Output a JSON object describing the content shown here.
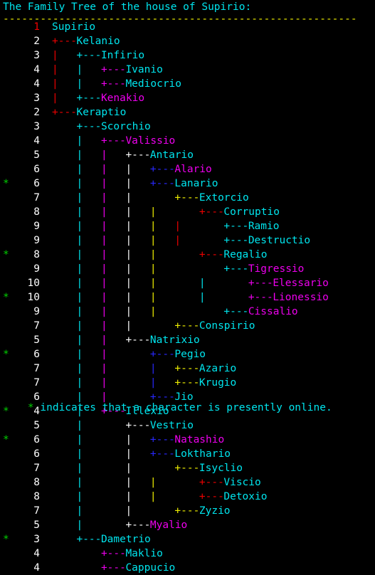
{
  "header": {
    "title": "The Family Tree of the house of Supirio:",
    "rule": "---------------------------------------------------------",
    "title_color": "#00e5ee",
    "rule_color": "#eeee00"
  },
  "footer": {
    "marker": "*",
    "text": " indicates that a character is presently online.",
    "marker_color": "#00d000",
    "text_color": "#00e5ee"
  },
  "legend": {
    "online_marker": "*",
    "online_meaning": "character is presently online"
  },
  "colors": {
    "depth_1": "#ee0000",
    "depth_2": "#ee0000",
    "depth_3": "#00e5ee",
    "depth_4": "#ee00ee",
    "depth_5": "#ffffff",
    "depth_6": "#2828ff",
    "depth_7": "#eeee00",
    "depth_8": "#ee0000",
    "depth_9": "#00e5ee",
    "depth_10": "#ee00ee",
    "name_cyan": "#00e5ee",
    "name_magenta": "#ee00ee",
    "number_white": "#ffffff",
    "number_root": "#ee0000",
    "online_green": "#00d000",
    "background": "#000000"
  },
  "tree": {
    "root": "Supirio",
    "columns": {
      "indent_per_level": 4,
      "connector": "+---",
      "vertical": "|"
    },
    "rows": [
      {
        "depth": 1,
        "name": "Supirio",
        "name_color": "cyan",
        "online": false,
        "prefix": [],
        "connector_color": null,
        "depth_color": "red"
      },
      {
        "depth": 2,
        "name": "Kelanio",
        "name_color": "cyan",
        "online": false,
        "prefix": [],
        "connector_color": "red",
        "depth_color": "white"
      },
      {
        "depth": 3,
        "name": "Infirio",
        "name_color": "cyan",
        "online": false,
        "prefix": [
          {
            "col": 0,
            "color": "red"
          }
        ],
        "connector_color": "cyan",
        "depth_color": "white"
      },
      {
        "depth": 4,
        "name": "Ivanio",
        "name_color": "cyan",
        "online": false,
        "prefix": [
          {
            "col": 0,
            "color": "red"
          },
          {
            "col": 1,
            "color": "cyan"
          }
        ],
        "connector_color": "magenta",
        "depth_color": "white"
      },
      {
        "depth": 4,
        "name": "Mediocrio",
        "name_color": "cyan",
        "online": false,
        "prefix": [
          {
            "col": 0,
            "color": "red"
          },
          {
            "col": 1,
            "color": "cyan"
          }
        ],
        "connector_color": "magenta",
        "depth_color": "white"
      },
      {
        "depth": 3,
        "name": "Kenakio",
        "name_color": "magenta",
        "online": false,
        "prefix": [
          {
            "col": 0,
            "color": "red"
          }
        ],
        "connector_color": "cyan",
        "depth_color": "white"
      },
      {
        "depth": 2,
        "name": "Keraptio",
        "name_color": "cyan",
        "online": false,
        "prefix": [],
        "connector_color": "red",
        "depth_color": "white"
      },
      {
        "depth": 3,
        "name": "Scorchio",
        "name_color": "cyan",
        "online": false,
        "prefix": [],
        "connector_color": "cyan",
        "depth_color": "white"
      },
      {
        "depth": 4,
        "name": "Valissio",
        "name_color": "magenta",
        "online": false,
        "prefix": [
          {
            "col": 1,
            "color": "cyan"
          }
        ],
        "connector_color": "magenta",
        "depth_color": "white"
      },
      {
        "depth": 5,
        "name": "Antario",
        "name_color": "cyan",
        "online": false,
        "prefix": [
          {
            "col": 1,
            "color": "cyan"
          },
          {
            "col": 2,
            "color": "magenta"
          }
        ],
        "connector_color": "white",
        "depth_color": "white"
      },
      {
        "depth": 6,
        "name": "Alario",
        "name_color": "magenta",
        "online": false,
        "prefix": [
          {
            "col": 1,
            "color": "cyan"
          },
          {
            "col": 2,
            "color": "magenta"
          },
          {
            "col": 3,
            "color": "white"
          }
        ],
        "connector_color": "blue",
        "depth_color": "white"
      },
      {
        "depth": 6,
        "name": "Lanario",
        "name_color": "cyan",
        "online": true,
        "prefix": [
          {
            "col": 1,
            "color": "cyan"
          },
          {
            "col": 2,
            "color": "magenta"
          },
          {
            "col": 3,
            "color": "white"
          }
        ],
        "connector_color": "blue",
        "depth_color": "white"
      },
      {
        "depth": 7,
        "name": "Extorcio",
        "name_color": "cyan",
        "online": false,
        "prefix": [
          {
            "col": 1,
            "color": "cyan"
          },
          {
            "col": 2,
            "color": "magenta"
          },
          {
            "col": 3,
            "color": "white"
          }
        ],
        "connector_color": "yellow",
        "depth_color": "white"
      },
      {
        "depth": 8,
        "name": "Corruptio",
        "name_color": "cyan",
        "online": false,
        "prefix": [
          {
            "col": 1,
            "color": "cyan"
          },
          {
            "col": 2,
            "color": "magenta"
          },
          {
            "col": 3,
            "color": "white"
          },
          {
            "col": 4,
            "color": "yellow"
          }
        ],
        "connector_color": "red",
        "depth_color": "white"
      },
      {
        "depth": 9,
        "name": "Ramio",
        "name_color": "cyan",
        "online": false,
        "prefix": [
          {
            "col": 1,
            "color": "cyan"
          },
          {
            "col": 2,
            "color": "magenta"
          },
          {
            "col": 3,
            "color": "white"
          },
          {
            "col": 4,
            "color": "yellow"
          },
          {
            "col": 5,
            "color": "red"
          }
        ],
        "connector_color": "cyan",
        "depth_color": "white"
      },
      {
        "depth": 9,
        "name": "Destructio",
        "name_color": "cyan",
        "online": false,
        "prefix": [
          {
            "col": 1,
            "color": "cyan"
          },
          {
            "col": 2,
            "color": "magenta"
          },
          {
            "col": 3,
            "color": "white"
          },
          {
            "col": 4,
            "color": "yellow"
          },
          {
            "col": 5,
            "color": "red"
          }
        ],
        "connector_color": "cyan",
        "depth_color": "white"
      },
      {
        "depth": 8,
        "name": "Regalio",
        "name_color": "cyan",
        "online": true,
        "prefix": [
          {
            "col": 1,
            "color": "cyan"
          },
          {
            "col": 2,
            "color": "magenta"
          },
          {
            "col": 3,
            "color": "white"
          },
          {
            "col": 4,
            "color": "yellow"
          }
        ],
        "connector_color": "red",
        "depth_color": "white"
      },
      {
        "depth": 9,
        "name": "Tigressio",
        "name_color": "magenta",
        "online": false,
        "prefix": [
          {
            "col": 1,
            "color": "cyan"
          },
          {
            "col": 2,
            "color": "magenta"
          },
          {
            "col": 3,
            "color": "white"
          },
          {
            "col": 4,
            "color": "yellow"
          }
        ],
        "connector_color": "cyan",
        "depth_color": "white"
      },
      {
        "depth": 10,
        "name": "Elessario",
        "name_color": "magenta",
        "online": false,
        "prefix": [
          {
            "col": 1,
            "color": "cyan"
          },
          {
            "col": 2,
            "color": "magenta"
          },
          {
            "col": 3,
            "color": "white"
          },
          {
            "col": 4,
            "color": "yellow"
          },
          {
            "col": 6,
            "color": "cyan"
          }
        ],
        "connector_color": "magenta",
        "depth_color": "white"
      },
      {
        "depth": 10,
        "name": "Lionessio",
        "name_color": "magenta",
        "online": true,
        "prefix": [
          {
            "col": 1,
            "color": "cyan"
          },
          {
            "col": 2,
            "color": "magenta"
          },
          {
            "col": 3,
            "color": "white"
          },
          {
            "col": 4,
            "color": "yellow"
          },
          {
            "col": 6,
            "color": "cyan"
          }
        ],
        "connector_color": "magenta",
        "depth_color": "white"
      },
      {
        "depth": 9,
        "name": "Cissalio",
        "name_color": "magenta",
        "online": false,
        "prefix": [
          {
            "col": 1,
            "color": "cyan"
          },
          {
            "col": 2,
            "color": "magenta"
          },
          {
            "col": 3,
            "color": "white"
          },
          {
            "col": 4,
            "color": "yellow"
          }
        ],
        "connector_color": "cyan",
        "depth_color": "white"
      },
      {
        "depth": 7,
        "name": "Conspirio",
        "name_color": "cyan",
        "online": false,
        "prefix": [
          {
            "col": 1,
            "color": "cyan"
          },
          {
            "col": 2,
            "color": "magenta"
          },
          {
            "col": 3,
            "color": "white"
          }
        ],
        "connector_color": "yellow",
        "depth_color": "white"
      },
      {
        "depth": 5,
        "name": "Natrixio",
        "name_color": "cyan",
        "online": false,
        "prefix": [
          {
            "col": 1,
            "color": "cyan"
          },
          {
            "col": 2,
            "color": "magenta"
          }
        ],
        "connector_color": "white",
        "depth_color": "white"
      },
      {
        "depth": 6,
        "name": "Pegio",
        "name_color": "cyan",
        "online": true,
        "prefix": [
          {
            "col": 1,
            "color": "cyan"
          },
          {
            "col": 2,
            "color": "magenta"
          }
        ],
        "connector_color": "blue",
        "depth_color": "white"
      },
      {
        "depth": 7,
        "name": "Azario",
        "name_color": "cyan",
        "online": false,
        "prefix": [
          {
            "col": 1,
            "color": "cyan"
          },
          {
            "col": 2,
            "color": "magenta"
          },
          {
            "col": 4,
            "color": "blue"
          }
        ],
        "connector_color": "yellow",
        "depth_color": "white"
      },
      {
        "depth": 7,
        "name": "Krugio",
        "name_color": "cyan",
        "online": false,
        "prefix": [
          {
            "col": 1,
            "color": "cyan"
          },
          {
            "col": 2,
            "color": "magenta"
          },
          {
            "col": 4,
            "color": "blue"
          }
        ],
        "connector_color": "yellow",
        "depth_color": "white"
      },
      {
        "depth": 6,
        "name": "Jio",
        "name_color": "cyan",
        "online": false,
        "prefix": [
          {
            "col": 1,
            "color": "cyan"
          },
          {
            "col": 2,
            "color": "magenta"
          }
        ],
        "connector_color": "blue",
        "depth_color": "white"
      },
      {
        "depth": 4,
        "name": "Illexio",
        "name_color": "cyan",
        "online": true,
        "prefix": [
          {
            "col": 1,
            "color": "cyan"
          }
        ],
        "connector_color": "magenta",
        "depth_color": "white"
      },
      {
        "depth": 5,
        "name": "Vestrio",
        "name_color": "cyan",
        "online": false,
        "prefix": [
          {
            "col": 1,
            "color": "cyan"
          }
        ],
        "connector_color": "white",
        "depth_color": "white"
      },
      {
        "depth": 6,
        "name": "Natashio",
        "name_color": "magenta",
        "online": true,
        "prefix": [
          {
            "col": 1,
            "color": "cyan"
          },
          {
            "col": 3,
            "color": "white"
          }
        ],
        "connector_color": "blue",
        "depth_color": "white"
      },
      {
        "depth": 6,
        "name": "Lokthario",
        "name_color": "cyan",
        "online": false,
        "prefix": [
          {
            "col": 1,
            "color": "cyan"
          },
          {
            "col": 3,
            "color": "white"
          }
        ],
        "connector_color": "blue",
        "depth_color": "white"
      },
      {
        "depth": 7,
        "name": "Isyclio",
        "name_color": "cyan",
        "online": false,
        "prefix": [
          {
            "col": 1,
            "color": "cyan"
          },
          {
            "col": 3,
            "color": "white"
          }
        ],
        "connector_color": "yellow",
        "depth_color": "white"
      },
      {
        "depth": 8,
        "name": "Viscio",
        "name_color": "cyan",
        "online": false,
        "prefix": [
          {
            "col": 1,
            "color": "cyan"
          },
          {
            "col": 3,
            "color": "white"
          },
          {
            "col": 4,
            "color": "yellow"
          }
        ],
        "connector_color": "red",
        "depth_color": "white"
      },
      {
        "depth": 8,
        "name": "Detoxio",
        "name_color": "cyan",
        "online": false,
        "prefix": [
          {
            "col": 1,
            "color": "cyan"
          },
          {
            "col": 3,
            "color": "white"
          },
          {
            "col": 4,
            "color": "yellow"
          }
        ],
        "connector_color": "red",
        "depth_color": "white"
      },
      {
        "depth": 7,
        "name": "Zyzio",
        "name_color": "cyan",
        "online": false,
        "prefix": [
          {
            "col": 1,
            "color": "cyan"
          },
          {
            "col": 3,
            "color": "white"
          }
        ],
        "connector_color": "yellow",
        "depth_color": "white"
      },
      {
        "depth": 5,
        "name": "Myalio",
        "name_color": "magenta",
        "online": false,
        "prefix": [
          {
            "col": 1,
            "color": "cyan"
          }
        ],
        "connector_color": "white",
        "depth_color": "white"
      },
      {
        "depth": 3,
        "name": "Dametrio",
        "name_color": "cyan",
        "online": true,
        "prefix": [],
        "connector_color": "cyan",
        "depth_color": "white"
      },
      {
        "depth": 4,
        "name": "Maklio",
        "name_color": "cyan",
        "online": false,
        "prefix": [],
        "connector_color": "magenta",
        "depth_color": "white"
      },
      {
        "depth": 4,
        "name": "Cappucio",
        "name_color": "cyan",
        "online": false,
        "prefix": [],
        "connector_color": "magenta",
        "depth_color": "white"
      }
    ]
  }
}
